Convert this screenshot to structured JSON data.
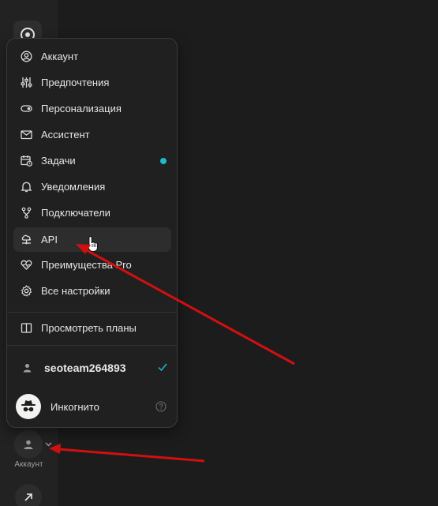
{
  "sidebar": {
    "logo_icon": "perplexity-logo-icon",
    "account_caption": "Аккаунт"
  },
  "menu": {
    "items": [
      {
        "label": "Аккаунт",
        "icon": "user-circle-icon"
      },
      {
        "label": "Предпочтения",
        "icon": "sliders-icon"
      },
      {
        "label": "Персонализация",
        "icon": "toggle-icon"
      },
      {
        "label": "Ассистент",
        "icon": "mail-icon"
      },
      {
        "label": "Задачи",
        "icon": "calendar-clock-icon",
        "badge_color": "#1fb8cd"
      },
      {
        "label": "Уведомления",
        "icon": "bell-icon"
      },
      {
        "label": "Подключатели",
        "icon": "git-branch-icon"
      },
      {
        "label": "API",
        "icon": "cloud-network-icon"
      },
      {
        "label": "Преимущества Pro",
        "icon": "heart-pulse-icon"
      },
      {
        "label": "Все настройки",
        "icon": "gear-icon"
      }
    ],
    "plans_label": "Просмотреть планы",
    "profile_name": "seoteam264893",
    "incognito_label": "Инкогнито"
  },
  "annotation_color": "#d01010"
}
